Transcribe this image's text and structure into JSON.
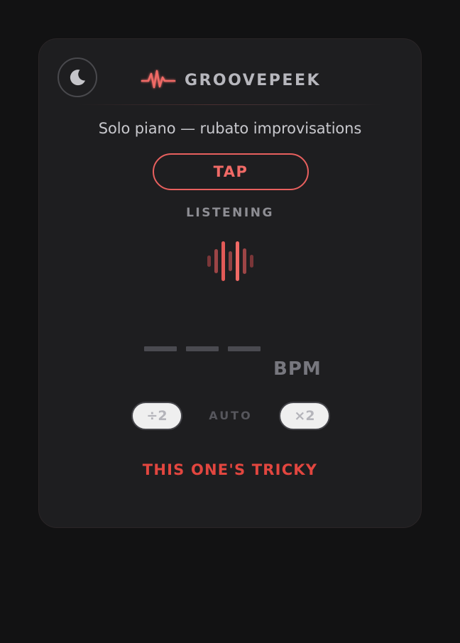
{
  "app": {
    "name": "GROOVEPEEK",
    "logo_icon": "pulse-wave-icon",
    "theme_icon": "moon-icon"
  },
  "track": {
    "description": "Solo piano — rubato improvisations"
  },
  "controls": {
    "tap_label": "TAP",
    "half_label": "÷2",
    "mode_label": "AUTO",
    "double_label": "×2"
  },
  "status": {
    "state": "LISTENING",
    "message": "THIS ONE'S TRICKY",
    "activity_icon": "audio-waveform-icon"
  },
  "readout": {
    "bpm_placeholder": "— — —",
    "unit": "BPM"
  },
  "colors": {
    "accent": "#f06a66",
    "warning": "#e2463f",
    "background": "#121213",
    "card": "#1e1e20"
  }
}
